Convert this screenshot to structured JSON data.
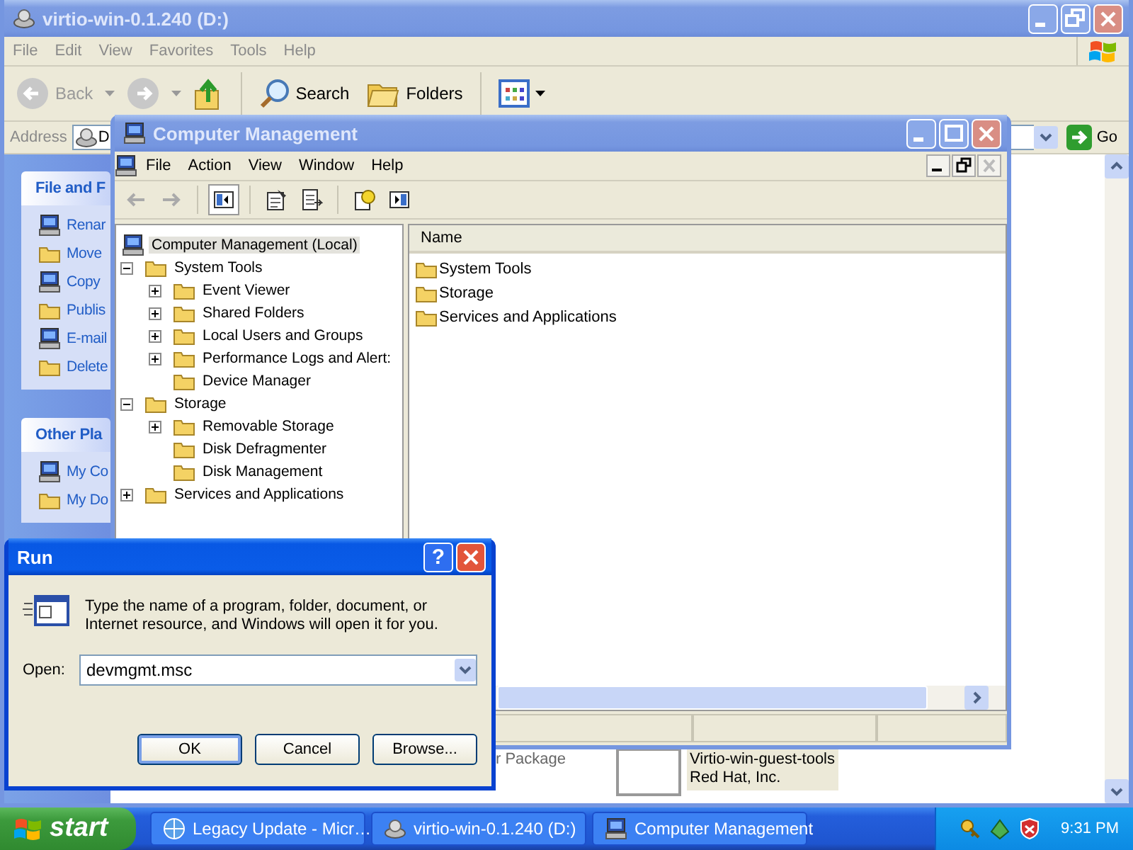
{
  "explorer": {
    "title": "virtio-win-0.1.240 (D:)",
    "active": false,
    "menu": [
      "File",
      "Edit",
      "View",
      "Favorites",
      "Tools",
      "Help"
    ],
    "toolbar": {
      "back": "Back",
      "search": "Search",
      "folders": "Folders"
    },
    "address": {
      "label": "Address",
      "value": "D",
      "go": "Go"
    },
    "task_pane": [
      {
        "title": "File and F",
        "items": [
          "Renar",
          "Move",
          "Copy",
          "Publis",
          "E-mail",
          "Delete"
        ]
      },
      {
        "title": "Other Pla",
        "items": [
          "My Co",
          "My Do"
        ]
      }
    ],
    "files": {
      "type": "r Package",
      "name": "Virtio-win-guest-tools",
      "company": "Red Hat, Inc."
    }
  },
  "mmc": {
    "title": "Computer Management",
    "active": false,
    "menu": [
      "File",
      "Action",
      "View",
      "Window",
      "Help"
    ],
    "tree": [
      {
        "label": "Computer Management (Local)",
        "selected": true,
        "children": [
          {
            "label": "System Tools",
            "selected": false,
            "expanded": true,
            "children": [
              {
                "label": "Event Viewer",
                "selected": false,
                "expanded": false
              },
              {
                "label": "Shared Folders",
                "selected": false,
                "expanded": false
              },
              {
                "label": "Local Users and Groups",
                "selected": false,
                "expanded": false
              },
              {
                "label": "Performance Logs and Alert:",
                "selected": false,
                "expanded": false
              },
              {
                "label": "Device Manager",
                "selected": false
              }
            ]
          },
          {
            "label": "Storage",
            "selected": false,
            "expanded": true,
            "children": [
              {
                "label": "Removable Storage",
                "selected": false,
                "expanded": false
              },
              {
                "label": "Disk Defragmenter",
                "selected": false
              },
              {
                "label": "Disk Management",
                "selected": false
              }
            ]
          },
          {
            "label": "Services and Applications",
            "selected": false,
            "expanded": false
          }
        ]
      }
    ],
    "list": {
      "columns": [
        "Name"
      ],
      "rows": [
        "System Tools",
        "Storage",
        "Services and Applications"
      ]
    }
  },
  "run": {
    "title": "Run",
    "active": true,
    "help": "?",
    "prompt": "Type the name of a program, folder, document, or Internet resource, and Windows will open it for you.",
    "open_label": "Open:",
    "value": "devmgmt.msc",
    "buttons": [
      {
        "label": "OK",
        "default": true
      },
      {
        "label": "Cancel",
        "default": false
      },
      {
        "label": "Browse...",
        "default": false
      }
    ]
  },
  "taskbar": {
    "start": "start",
    "tasks": [
      {
        "label": "Legacy Update - Micr…",
        "selected": false
      },
      {
        "label": "virtio-win-0.1.240 (D:)",
        "selected": false
      },
      {
        "label": "Computer Management",
        "selected": false
      }
    ],
    "clock": "9:31 PM"
  }
}
